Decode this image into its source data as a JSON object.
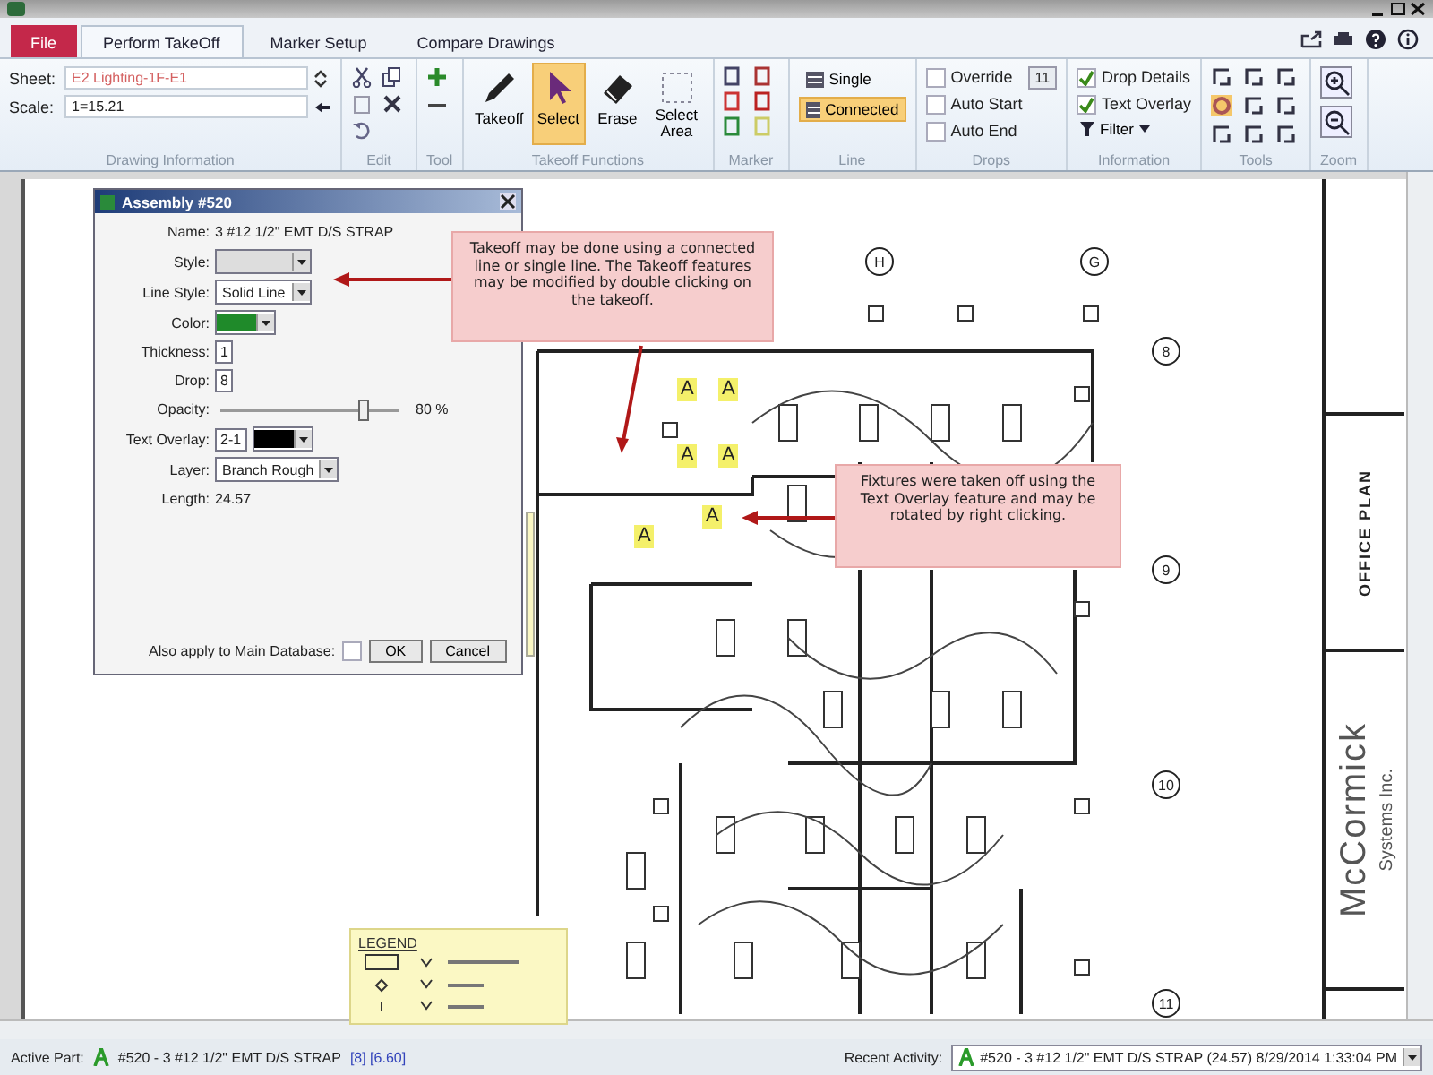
{
  "tabs": [
    {
      "label": "File",
      "kind": "file",
      "selected": false
    },
    {
      "label": "Perform TakeOff",
      "kind": "tab",
      "selected": true
    },
    {
      "label": "Marker Setup",
      "kind": "tab",
      "selected": false
    },
    {
      "label": "Compare Drawings",
      "kind": "tab",
      "selected": false
    }
  ],
  "ribbon_groups": [
    {
      "kind": "fields",
      "label": "Drawing Information",
      "fields": [
        {
          "label": "Sheet:",
          "value": "E2 Lighting-1F-E1"
        },
        {
          "label": "Scale:",
          "value": "1=15.21"
        }
      ]
    },
    {
      "kind": "edit",
      "label": "Edit"
    },
    {
      "kind": "tool",
      "label": "Tool"
    },
    {
      "kind": "buttons",
      "label": "Takeoff Functions",
      "buttons": [
        {
          "label": "Takeoff",
          "selected": false
        },
        {
          "label": "Select",
          "selected": true
        },
        {
          "label": "Erase",
          "selected": false
        },
        {
          "label": "Select Area",
          "selected": false
        }
      ]
    },
    {
      "kind": "marker",
      "label": "Marker"
    },
    {
      "kind": "options",
      "label": "Line",
      "options": [
        {
          "label": "Single",
          "selected": false
        },
        {
          "label": "Connected",
          "selected": true
        }
      ]
    },
    {
      "kind": "checks",
      "label": "Drops",
      "checks": [
        {
          "label": "Override",
          "checked": false
        },
        {
          "label": "Auto Start",
          "checked": false
        },
        {
          "label": "Auto End",
          "checked": false
        }
      ],
      "count": "11"
    },
    {
      "kind": "checks",
      "label": "Information",
      "checks": [
        {
          "label": "Drop Details",
          "checked": true
        },
        {
          "label": "Text Overlay",
          "checked": true
        }
      ],
      "filter": "Filter"
    },
    {
      "kind": "tools",
      "label": "Tools"
    },
    {
      "kind": "zoom",
      "label": "Zoom"
    }
  ],
  "dialog": {
    "title": "Assembly #520",
    "fields": [
      {
        "kind": "text",
        "label": "Name:",
        "value": "3 #12 1/2\" EMT D/S STRAP"
      },
      {
        "kind": "select",
        "label": "Style:",
        "disabled": true
      },
      {
        "kind": "select",
        "label": "Line Style:",
        "value": "Solid Line",
        "disabled": false
      },
      {
        "kind": "color",
        "label": "Color:",
        "color": "#1f8a2a"
      },
      {
        "kind": "input",
        "label": "Thickness:",
        "value": "1"
      },
      {
        "kind": "input",
        "label": "Drop:",
        "value": "8"
      },
      {
        "kind": "slider",
        "label": "Opacity:",
        "level": 0.8,
        "reading": "80 %"
      },
      {
        "kind": "overlay",
        "label": "Text Overlay:",
        "value": "2-1",
        "color": "#000000"
      },
      {
        "kind": "select",
        "label": "Layer:",
        "value": "Branch Rough",
        "disabled": false
      },
      {
        "kind": "text",
        "label": "Length:",
        "value": "24.57"
      }
    ],
    "apply": {
      "label": "Also apply to Main Database:",
      "checked": false
    },
    "buttons": [
      "OK",
      "Cancel"
    ]
  },
  "callouts": [
    "Takeoff may be done using a connected line or single line. The Takeoff features may be modified by double clicking on the takeoff.",
    "Fixtures were taken off using the Text Overlay feature and may be rotated by right clicking."
  ],
  "grid_bubbles": [
    "H",
    "G",
    "8",
    "9",
    "10",
    "11"
  ],
  "fixture_labels": [
    "A",
    "A",
    "A",
    "A",
    "A",
    "A"
  ],
  "legend_title": "LEGEND",
  "title_block": {
    "sheet_title": "OFFICE PLAN",
    "company": "McCormick",
    "company_sub": "Systems Inc."
  },
  "status_bar": {
    "active_label": "Active Part:",
    "active_part": "#520 - 3 #12 1/2\" EMT D/S STRAP",
    "active_extra": "[8] [6.60]",
    "recent_label": "Recent Activity:",
    "recent": "#520 - 3 #12 1/2\" EMT D/S STRAP (24.57) 8/29/2014 1:33:04 PM"
  }
}
